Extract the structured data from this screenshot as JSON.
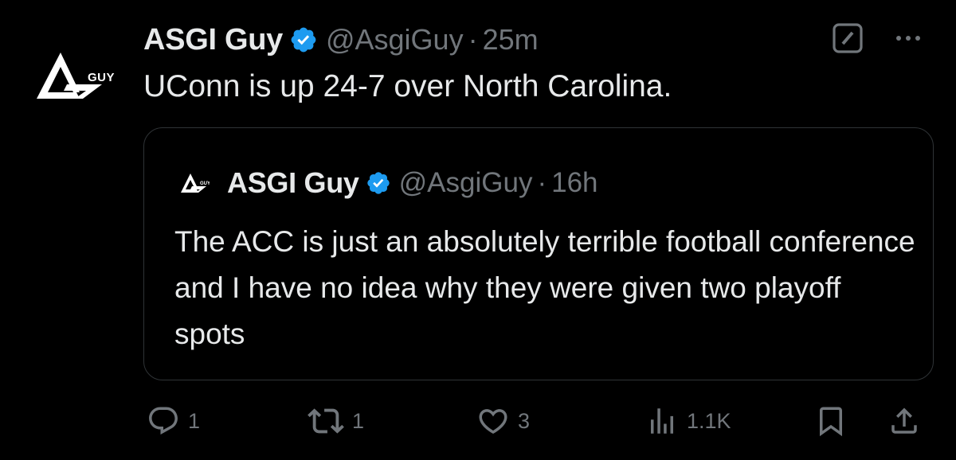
{
  "tweet": {
    "author": {
      "name": "ASGI Guy",
      "handle": "@AsgiGuy",
      "time": "25m",
      "verified": true,
      "avatar_logo_text": "GUY"
    },
    "separator": "·",
    "text": "UConn is up 24-7 over North Carolina.",
    "top_actions": [
      "grok-icon",
      "more-icon"
    ]
  },
  "quote": {
    "author": {
      "name": "ASGI Guy",
      "handle": "@AsgiGuy",
      "time": "16h",
      "verified": true
    },
    "separator": "·",
    "text": "The ACC is just an absolutely terrible football conference and I have no idea why they were given two playoff spots"
  },
  "actions": {
    "reply_count": "1",
    "repost_count": "1",
    "like_count": "3",
    "views_count": "1.1K"
  },
  "colors": {
    "background": "#000000",
    "text": "#e7e9ea",
    "secondary": "#71767b",
    "border": "#2f3336",
    "verified": "#1d9bf0"
  }
}
